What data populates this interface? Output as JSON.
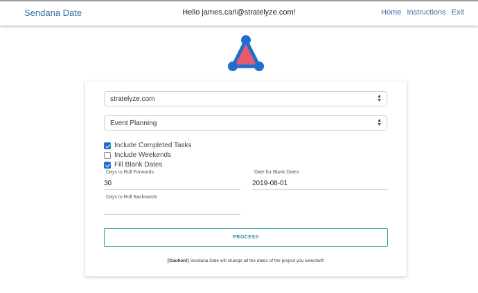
{
  "navbar": {
    "brand": "Sendana Date",
    "greeting_prefix": "Hello ",
    "user_email": "james.carl@stratelyze.com",
    "greeting_suffix": "!",
    "links": {
      "home": "Home",
      "instructions": "Instructions",
      "exit": "Exit"
    }
  },
  "logo": {
    "icon": "triangle-network-logo",
    "colors": {
      "frame": "#1f6fd1",
      "fill": "#e85a6b"
    }
  },
  "form": {
    "workspace_select": {
      "value": "stratelyze.com"
    },
    "project_select": {
      "value": "Event Planning"
    },
    "checkboxes": {
      "completed": {
        "label": "Include Completed Tasks",
        "checked": true
      },
      "weekends": {
        "label": "Include Weekends",
        "checked": false
      },
      "blank": {
        "label": "Fill Blank Dates",
        "checked": true
      }
    },
    "days_forward": {
      "label": "Days to Roll Forwards",
      "value": "30"
    },
    "blank_date": {
      "label": "Date for Blank Dates",
      "value": "2019-08-01"
    },
    "days_backward": {
      "label": "Days to Roll Backwards",
      "value": ""
    },
    "process_label": "PROCESS",
    "caution": {
      "tag": "[Caution!]",
      "text": " Sendana Date will change all the dates of the project you selected!!"
    }
  },
  "colors": {
    "accent": "#1f6fd1",
    "brand_text": "#3a6ea5",
    "process_border": "#2aa5a5"
  }
}
